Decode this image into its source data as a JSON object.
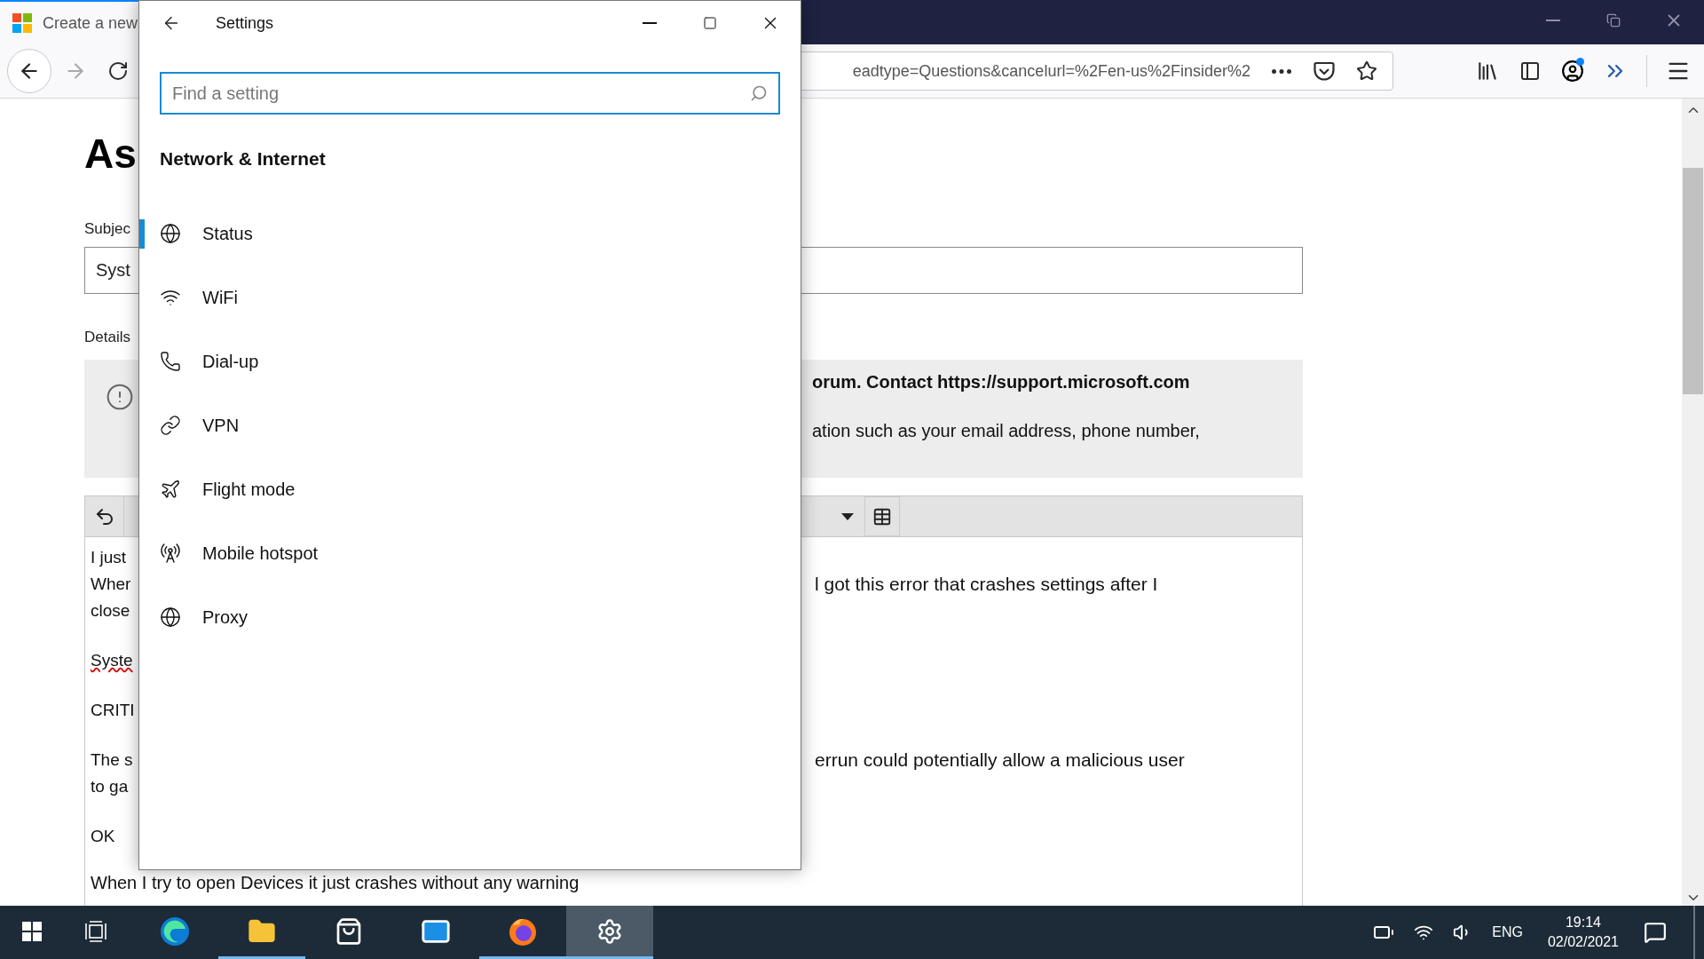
{
  "browser": {
    "tab": {
      "title": "Create a new"
    },
    "address": "eadtype=Questions&cancelurl=%2Fen-us%2Finsider%2",
    "page": {
      "heading": "As",
      "subject_label": "Subjec",
      "subject_value": "Syst",
      "details_label": "Details",
      "notice": {
        "warning": "orum. Contact https://support.microsoft.com",
        "body": "ation such as your email address, phone number,"
      },
      "editor": {
        "paragraphs": [
          [
            {
              "kind": "split",
              "left": "I just",
              "misspelled": false
            },
            {
              "kind": "split",
              "left": "Wher",
              "right": "l got this error that crashes settings after I",
              "misspelled": false
            },
            {
              "kind": "split",
              "left": "close",
              "misspelled": false
            }
          ],
          [
            {
              "kind": "split",
              "left": "Syste",
              "misspelled": true
            }
          ],
          [
            {
              "kind": "split",
              "left": "CRITI",
              "misspelled": false
            }
          ],
          [
            {
              "kind": "split",
              "left": "The s",
              "right": "errun could potentially allow a malicious user",
              "misspelled": false
            },
            {
              "kind": "split",
              "left": "to ga",
              "misspelled": false
            }
          ],
          [
            {
              "kind": "split",
              "left": "OK",
              "misspelled": false
            }
          ],
          [
            {
              "kind": "full",
              "left": "When I try to open Devices it just crashes without any warning",
              "misspelled": false
            }
          ]
        ]
      }
    }
  },
  "settings": {
    "title": "Settings",
    "search": {
      "placeholder": "Find a setting"
    },
    "section": "Network & Internet",
    "nav": [
      {
        "label": "Status",
        "kind": "status",
        "selected": true
      },
      {
        "label": "WiFi",
        "kind": "wifi",
        "selected": false
      },
      {
        "label": "Dial-up",
        "kind": "dialup",
        "selected": false
      },
      {
        "label": "VPN",
        "kind": "vpn",
        "selected": false
      },
      {
        "label": "Flight mode",
        "kind": "flight",
        "selected": false
      },
      {
        "label": "Mobile hotspot",
        "kind": "hotspot",
        "selected": false
      },
      {
        "label": "Proxy",
        "kind": "proxy",
        "selected": false
      }
    ]
  },
  "taskbar": {
    "apps": [
      {
        "kind": "edge",
        "running": false,
        "selected": false
      },
      {
        "kind": "explorer",
        "running": true,
        "selected": false
      },
      {
        "kind": "store",
        "running": false,
        "selected": false
      },
      {
        "kind": "mail",
        "running": false,
        "selected": false
      },
      {
        "kind": "firefox",
        "running": true,
        "selected": false
      },
      {
        "kind": "settings",
        "running": true,
        "selected": true
      }
    ],
    "language": "ENG",
    "time": "19:14",
    "date": "02/02/2021"
  }
}
